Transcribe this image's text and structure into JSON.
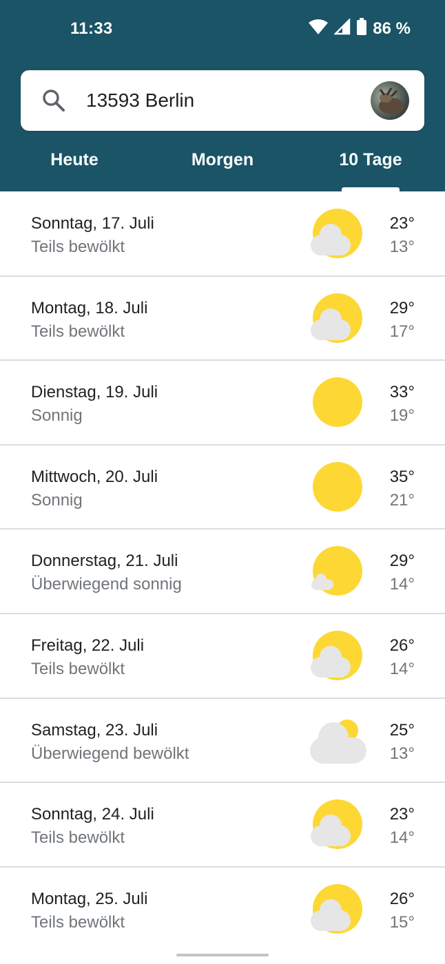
{
  "status_bar": {
    "time": "11:33",
    "battery": "86 %",
    "icons": [
      "wifi-icon",
      "signal-icon",
      "battery-icon"
    ]
  },
  "search": {
    "location": "13593 Berlin",
    "icon": "search-icon",
    "avatar": "account-avatar"
  },
  "tabs": [
    {
      "label": "Heute",
      "selected": false
    },
    {
      "label": "Morgen",
      "selected": false
    },
    {
      "label": "10 Tage",
      "selected": true
    }
  ],
  "days": [
    {
      "date": "Sonntag, 17. Juli",
      "condition": "Teils bewölkt",
      "high": "23°",
      "low": "13°",
      "icon": "partly-cloudy-icon"
    },
    {
      "date": "Montag, 18. Juli",
      "condition": "Teils bewölkt",
      "high": "29°",
      "low": "17°",
      "icon": "partly-cloudy-icon"
    },
    {
      "date": "Dienstag, 19. Juli",
      "condition": "Sonnig",
      "high": "33°",
      "low": "19°",
      "icon": "sunny-icon"
    },
    {
      "date": "Mittwoch, 20. Juli",
      "condition": "Sonnig",
      "high": "35°",
      "low": "21°",
      "icon": "sunny-icon"
    },
    {
      "date": "Donnerstag, 21. Juli",
      "condition": "Überwiegend sonnig",
      "high": "29°",
      "low": "14°",
      "icon": "mostly-sunny-icon"
    },
    {
      "date": "Freitag, 22. Juli",
      "condition": "Teils bewölkt",
      "high": "26°",
      "low": "14°",
      "icon": "partly-cloudy-icon"
    },
    {
      "date": "Samstag, 23. Juli",
      "condition": "Überwiegend bewölkt",
      "high": "25°",
      "low": "13°",
      "icon": "mostly-cloudy-icon"
    },
    {
      "date": "Sonntag, 24. Juli",
      "condition": "Teils bewölkt",
      "high": "23°",
      "low": "14°",
      "icon": "partly-cloudy-icon"
    },
    {
      "date": "Montag, 25. Juli",
      "condition": "Teils bewölkt",
      "high": "26°",
      "low": "15°",
      "icon": "partly-cloudy-icon"
    }
  ],
  "colors": {
    "header": "#1a5466",
    "sun": "#fdd835",
    "cloud": "#e8e8e8"
  }
}
